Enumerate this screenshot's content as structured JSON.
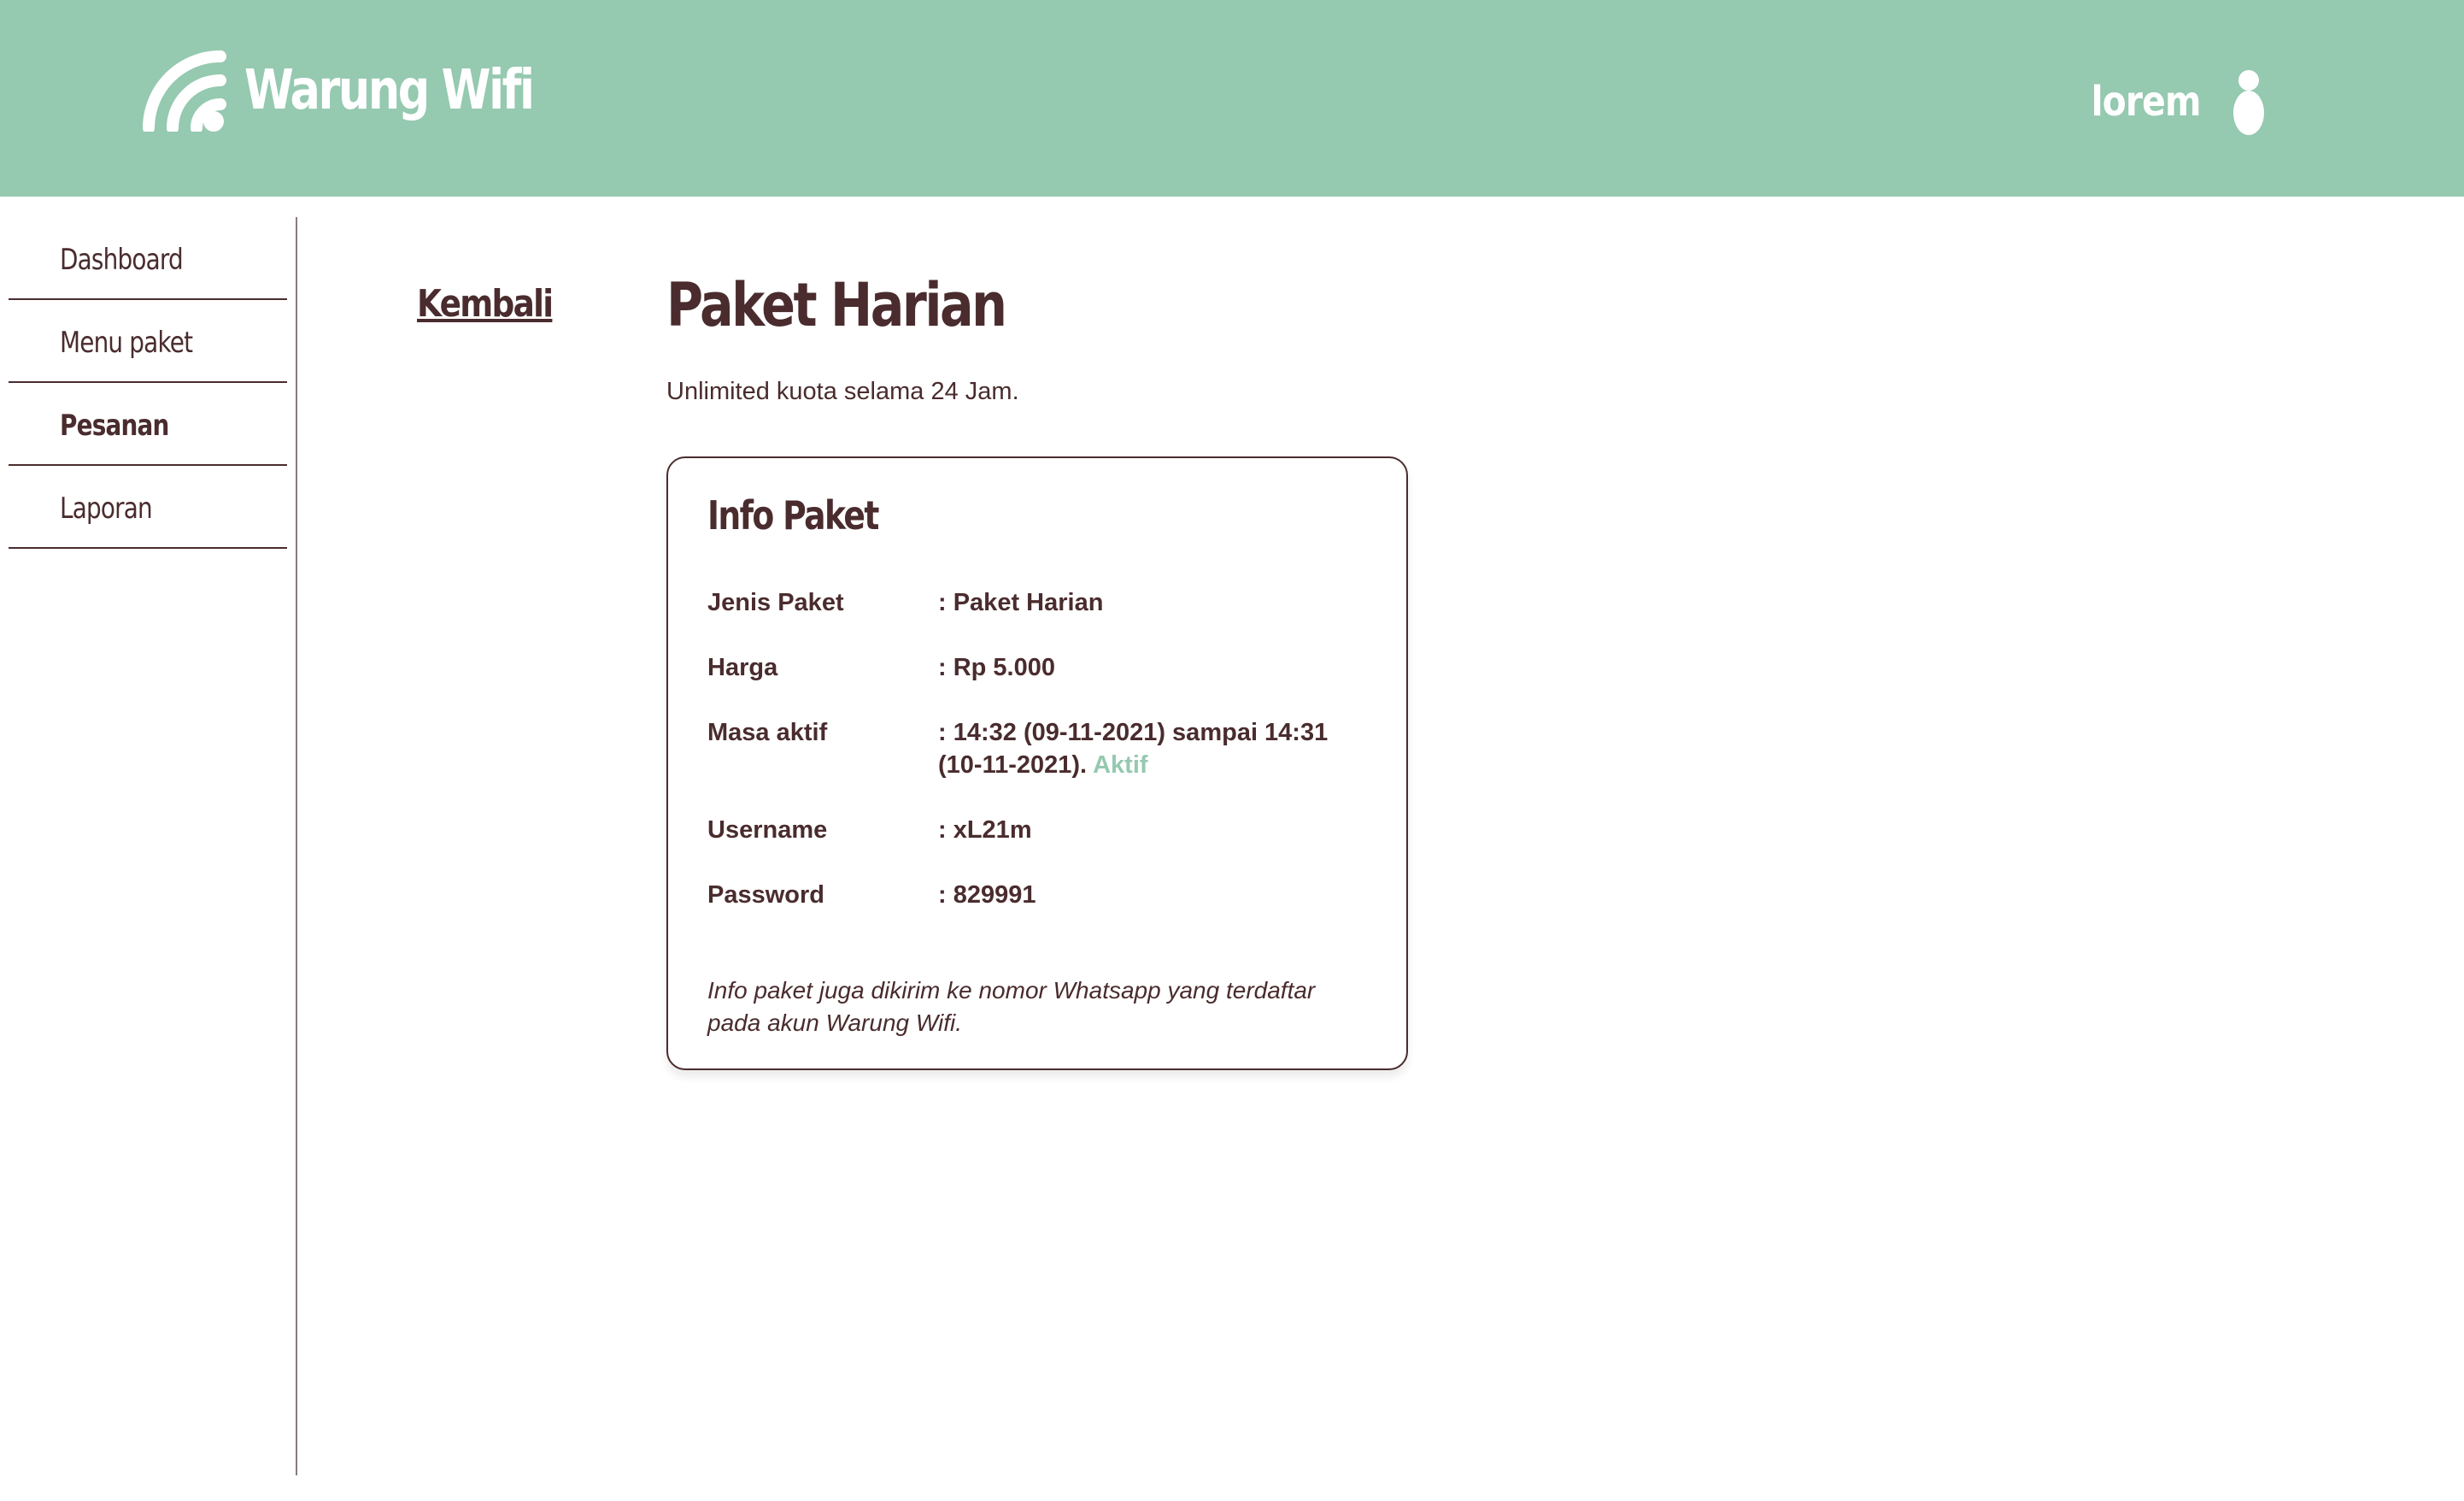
{
  "header": {
    "brand_name": "Warung Wifi",
    "brand_icon": "wifi-icon",
    "user_name": "lorem",
    "user_icon": "user-icon"
  },
  "sidebar": {
    "items": [
      {
        "label": "Dashboard",
        "active": false
      },
      {
        "label": "Menu paket",
        "active": false
      },
      {
        "label": "Pesanan",
        "active": true
      },
      {
        "label": "Laporan",
        "active": false
      }
    ]
  },
  "main": {
    "back_label": "Kembali",
    "title": "Paket Harian",
    "description": "Unlimited kuota selama 24 Jam."
  },
  "card": {
    "title": "Info Paket",
    "rows": [
      {
        "label": "Jenis Paket",
        "value": ": Paket Harian"
      },
      {
        "label": "Harga",
        "value": ": Rp 5.000"
      },
      {
        "label": "Masa aktif",
        "value": ": 14:32 (09-11-2021) sampai 14:31 (10-11-2021).",
        "status": "Aktif"
      },
      {
        "label": "Username",
        "value": ": xL21m"
      },
      {
        "label": "Password",
        "value": ": 829991"
      }
    ],
    "note": "Info paket juga dikirim ke nomor Whatsapp yang terdaftar pada akun Warung Wifi."
  },
  "colors": {
    "header_bg": "#95c9b0",
    "text_primary": "#4a2c2e",
    "status_active": "#95c9b0"
  }
}
